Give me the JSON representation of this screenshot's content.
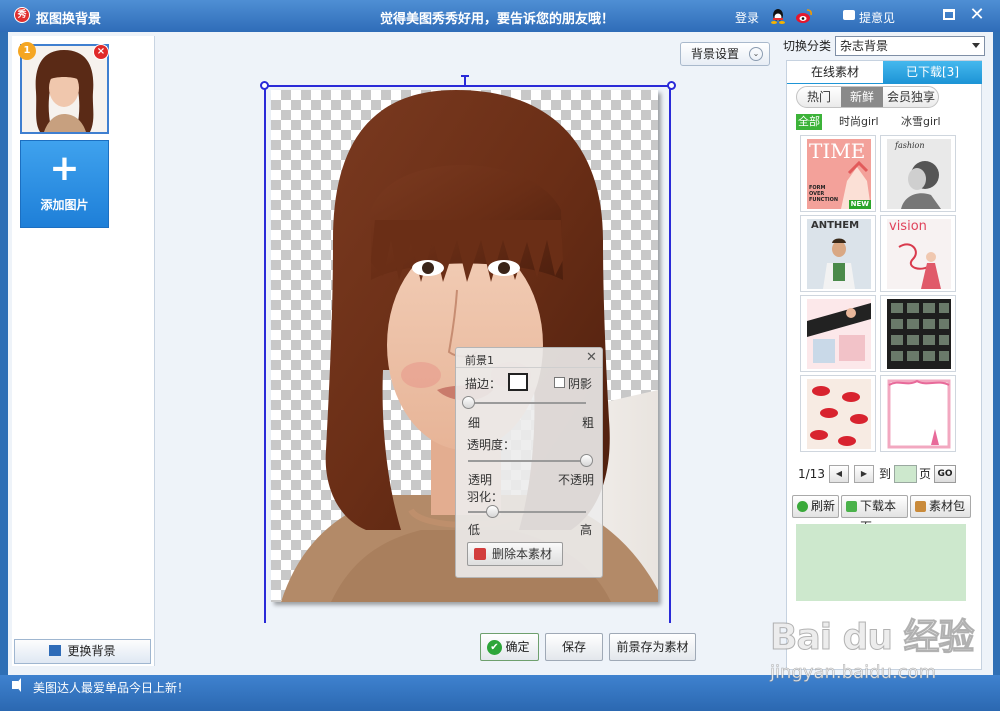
{
  "titlebar": {
    "app_title": "抠图换背景",
    "app_logo": "秀",
    "slogan": "觉得美图秀秀好用，要告诉您的朋友哦！",
    "login": "登录",
    "feedback": "提意见",
    "close_glyph": "✕"
  },
  "left_panel": {
    "thumb_badge": "1",
    "thumb_close": "×",
    "add_plus": "+",
    "add_label": "添加图片",
    "change_bg": "更换背景"
  },
  "canvas": {
    "bg_settings": "背景设置",
    "chevron": "⌄"
  },
  "subpanel": {
    "title": "前景1",
    "close": "✕",
    "stroke_label": "描边：",
    "shadow_label": "阴影",
    "thin": "细",
    "thick": "粗",
    "opacity_label": "透明度：",
    "transparent": "透明",
    "opaque": "不透明",
    "feather_label": "羽化：",
    "low": "低",
    "high": "高",
    "delete_material": "删除本素材",
    "stroke_level": 0.0,
    "opacity_level": 1.0,
    "feather_level": 0.2
  },
  "bottom_buttons": {
    "confirm": "确定",
    "save": "保存",
    "save_foreground": "前景存为素材"
  },
  "right_panel": {
    "category_label": "切换分类",
    "category_value": "杂志背景",
    "tab_online": "在线素材",
    "tab_downloaded": "已下载[3]",
    "pills": [
      "热门",
      "新鲜",
      "会员独享"
    ],
    "active_pill": "新鲜",
    "filters": [
      "全部",
      "时尚girl",
      "冰雪girl"
    ],
    "thumb_titles": {
      "time": "TIME",
      "time_sub": "FORM OVER FUNCTION",
      "fashion": "fashion",
      "anthem": "ANTHEM",
      "vision": "vision"
    },
    "new_badge": "NEW",
    "page_info": "1/13",
    "prev": "◀",
    "next": "▶",
    "to": "到",
    "page_unit": "页",
    "go": "GO",
    "refresh": "刷新",
    "download_page": "下载本页",
    "material_pack": "素材包"
  },
  "statusbar": {
    "text": "美图达人最爱单品今日上新！"
  },
  "watermark": {
    "main": "Bai du 经验",
    "sub": "jingyan.baidu.com"
  },
  "colors": {
    "accent_blue": "#2f6cb8",
    "tab_blue": "#1e95d6",
    "selection_blue": "#2a2ad8",
    "filter_green": "#3cb339"
  }
}
